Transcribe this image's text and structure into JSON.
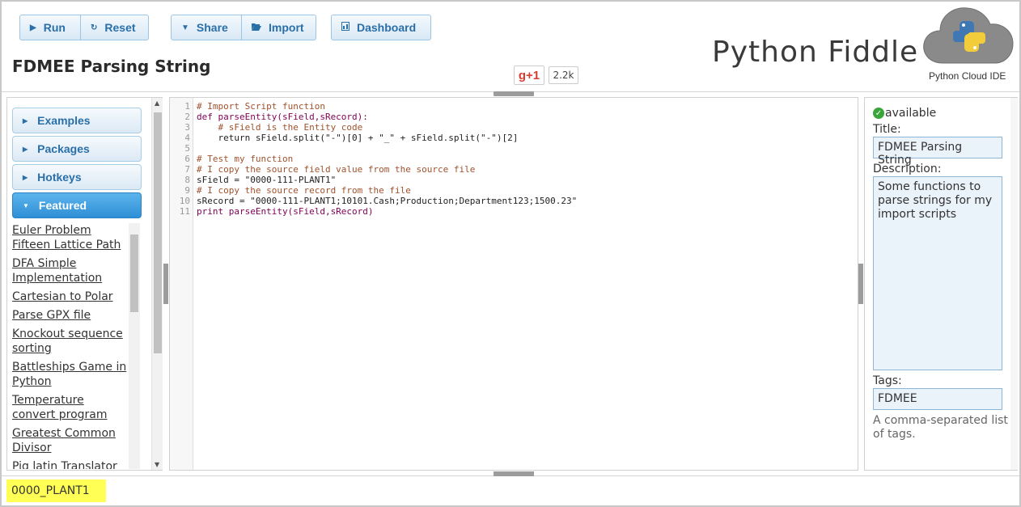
{
  "toolbar": {
    "run_label": "Run",
    "reset_label": "Reset",
    "share_label": "Share",
    "import_label": "Import",
    "dashboard_label": "Dashboard"
  },
  "header": {
    "title": "FDMEE Parsing String",
    "brand_name": "Python Fiddle",
    "brand_sub": "Python Cloud IDE",
    "gplus_label": "g+1",
    "gplus_count": "2.2k"
  },
  "sidebar": {
    "sections": [
      "Examples",
      "Packages",
      "Hotkeys",
      "Featured"
    ],
    "featured_items": [
      "Euler Problem Fifteen Lattice Path",
      "DFA Simple Implementation",
      "Cartesian to Polar",
      "Parse GPX file",
      "Knockout sequence sorting",
      "Battleships Game in Python",
      "Temperature convert program",
      "Greatest Common Divisor",
      "Pig latin Translator"
    ]
  },
  "editor": {
    "lines": [
      "# Import Script function",
      "def parseEntity(sField,sRecord):",
      "    # sField is the Entity code",
      "    return sField.split(\"-\")[0] + \"_\" + sField.split(\"-\")[2]",
      "",
      "# Test my function",
      "# I copy the source field value from the source file",
      "sField = \"0000-111-PLANT1\"",
      "# I copy the source record from the file",
      "sRecord = \"0000-111-PLANT1;10101.Cash;Production;Department123;1500.23\"",
      "print parseEntity(sField,sRecord)"
    ]
  },
  "details": {
    "status": "available",
    "title_label": "Title:",
    "title_value": "FDMEE Parsing String",
    "description_label": "Description:",
    "description_value": "Some functions to parse strings for my import scripts",
    "tags_label": "Tags:",
    "tags_value": "FDMEE",
    "tags_hint": "A comma-separated list of tags."
  },
  "output": {
    "text": "0000_PLANT1"
  },
  "colors": {
    "accent": "#2a6fa8",
    "featured_active": "#3a9be0",
    "output_highlight": "#ffff55"
  }
}
